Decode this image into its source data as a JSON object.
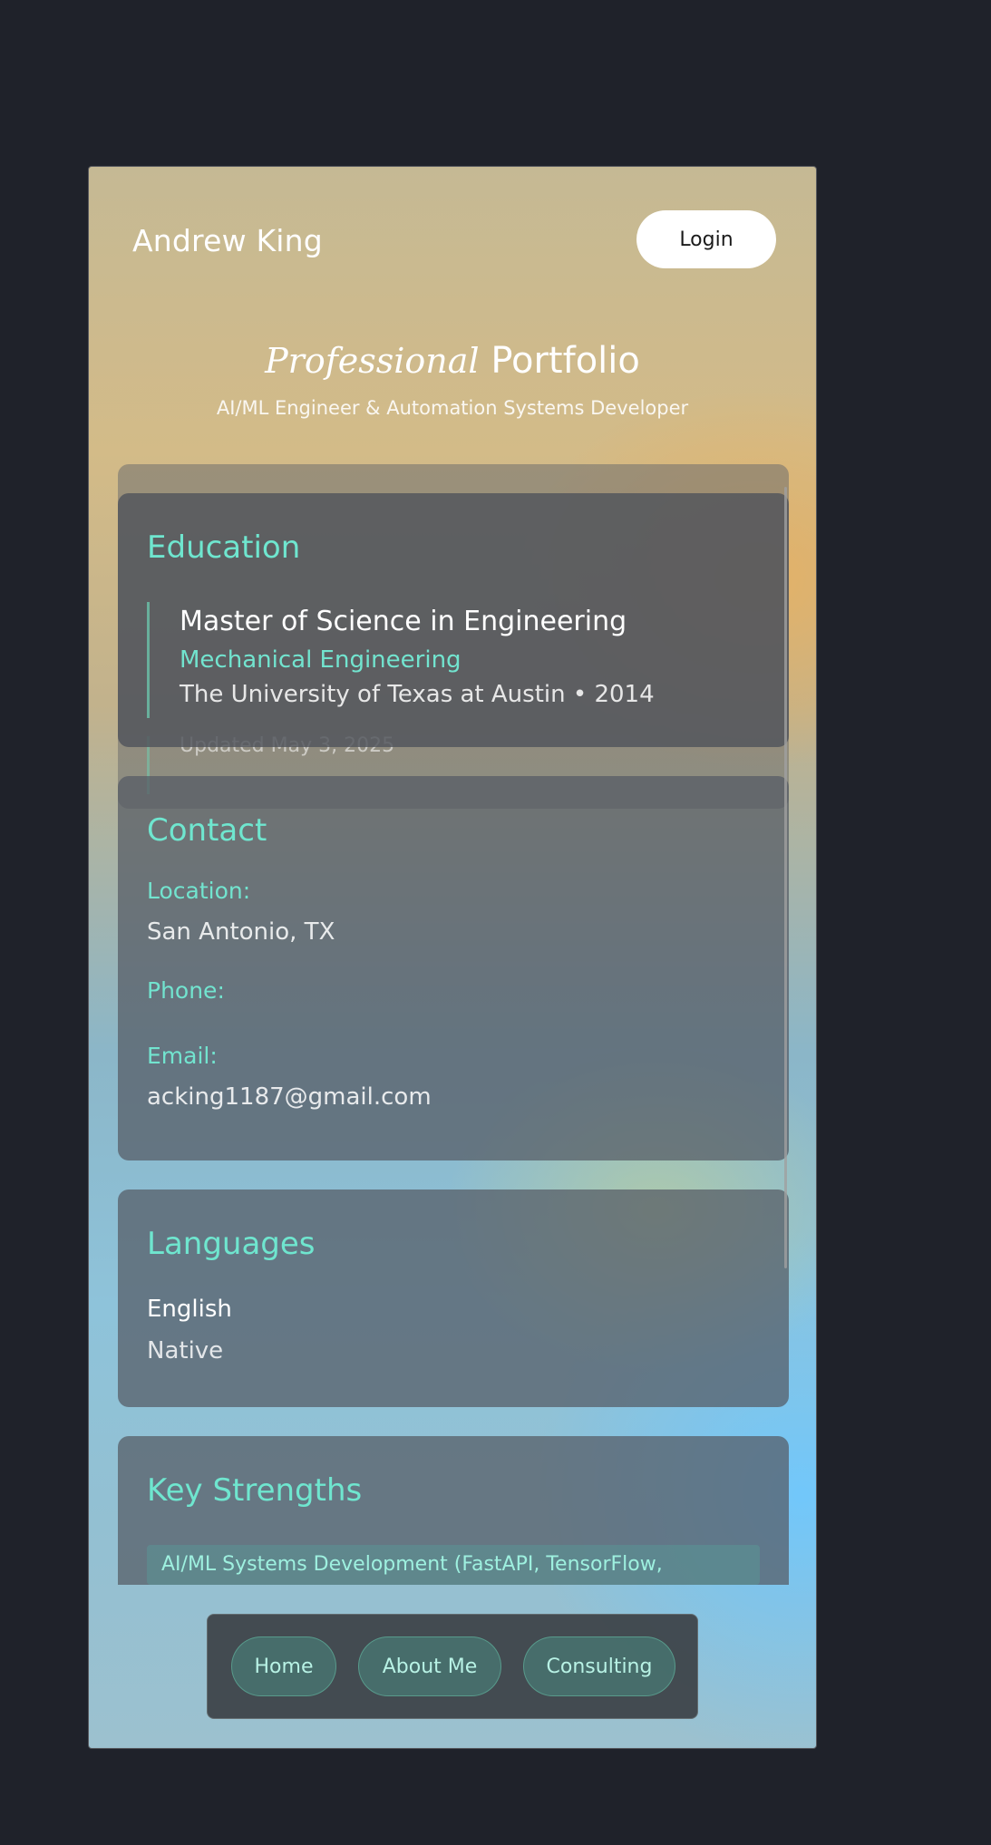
{
  "header": {
    "brand": "Andrew King",
    "login_label": "Login"
  },
  "hero": {
    "title_italic": "Professional",
    "title_rest": "Portfolio",
    "subtitle": "AI/ML Engineer & Automation Systems Developer"
  },
  "ghost": {
    "updated_text": "Updated May 3, 2025"
  },
  "education": {
    "title": "Education",
    "degree": "Master of Science in Engineering",
    "field": "Mechanical Engineering",
    "school_line": "The University of Texas at Austin • 2014"
  },
  "contact": {
    "title": "Contact",
    "location_label": "Location:",
    "location_value": "San Antonio, TX",
    "phone_label": "Phone:",
    "email_label": "Email:",
    "email_value": "acking1187@gmail.com"
  },
  "languages": {
    "title": "Languages",
    "items": [
      {
        "name": "English",
        "level": "Native"
      }
    ]
  },
  "strengths": {
    "title": "Key Strengths",
    "items": [
      "AI/ML Systems Development (FastAPI, TensorFlow,"
    ]
  },
  "nav": {
    "items": [
      {
        "label": "Home"
      },
      {
        "label": "About Me"
      },
      {
        "label": "Consulting"
      }
    ]
  },
  "colors": {
    "page_bg": "#1f222a",
    "accent": "#6fe6cf",
    "login_bg": "#ffffff"
  }
}
